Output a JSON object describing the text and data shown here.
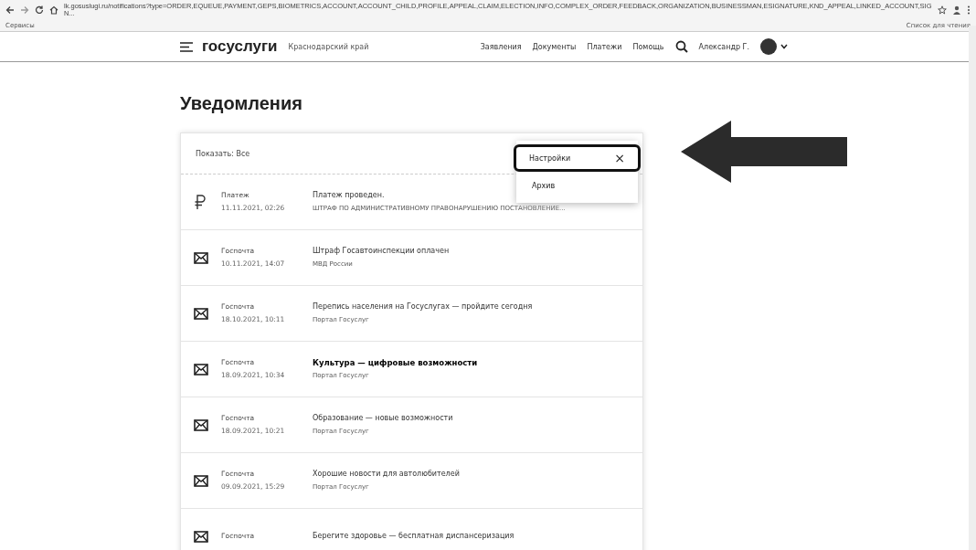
{
  "browser": {
    "url": "lk.gosuslugi.ru/notifications?type=ORDER,EQUEUE,PAYMENT,GEPS,BIOMETRICS,ACCOUNT,ACCOUNT_CHILD,PROFILE,APPEAL,CLAIM,ELECTION,INFO,COMPLEX_ORDER,FEEDBACK,ORGANIZATION,BUSINESSMAN,ESIGNATURE,KND_APPEAL,LINKED_ACCOUNT,SIGN...",
    "bookmarks": [
      "Сервисы"
    ],
    "reading_list": "Список для чтения"
  },
  "header": {
    "logo": "госуслуги",
    "region": "Краснодарский край",
    "nav": [
      "Заявления",
      "Документы",
      "Платежи",
      "Помощь"
    ],
    "user": "Александр Г."
  },
  "page_title": "Уведомления",
  "filter": "Показать: Все",
  "menu": [
    {
      "label": "Настройки",
      "highlighted": true,
      "close": "×"
    },
    {
      "label": "Архив",
      "highlighted": false
    }
  ],
  "notifications": [
    {
      "kind": "payment",
      "sender": "Платеж",
      "date": "11.11.2021, 02:26",
      "title": "Платеж проведен.",
      "subtitle": "ШТРАФ ПО АДМИНИСТРАТИВНОМУ ПРАВОНАРУШЕНИЮ ПОСТАНОВЛЕНИЕ...",
      "unread": false
    },
    {
      "kind": "mail",
      "sender": "Госпочта",
      "date": "10.11.2021, 14:07",
      "title": "Штраф Госавтоинспекции оплачен",
      "subtitle": "МВД России",
      "unread": false
    },
    {
      "kind": "mail",
      "sender": "Госпочта",
      "date": "18.10.2021, 10:11",
      "title": "Перепись населения на Госуслугах — пройдите сегодня",
      "subtitle": "Портал Госуслуг",
      "unread": false
    },
    {
      "kind": "mail",
      "sender": "Госпочта",
      "date": "18.09.2021, 10:34",
      "title": "Культура — цифровые возможности",
      "subtitle": "Портал Госуслуг",
      "unread": true
    },
    {
      "kind": "mail",
      "sender": "Госпочта",
      "date": "18.09.2021, 10:21",
      "title": "Образование — новые возможности",
      "subtitle": "Портал Госуслуг",
      "unread": false
    },
    {
      "kind": "mail",
      "sender": "Госпочта",
      "date": "09.09.2021, 15:29",
      "title": "Хорошие новости для автолюбителей",
      "subtitle": "Портал Госуслуг",
      "unread": false
    },
    {
      "kind": "mail",
      "sender": "Госпочта",
      "title": "Берегите здоровье — бесплатная диспансеризация",
      "unread": false
    }
  ]
}
